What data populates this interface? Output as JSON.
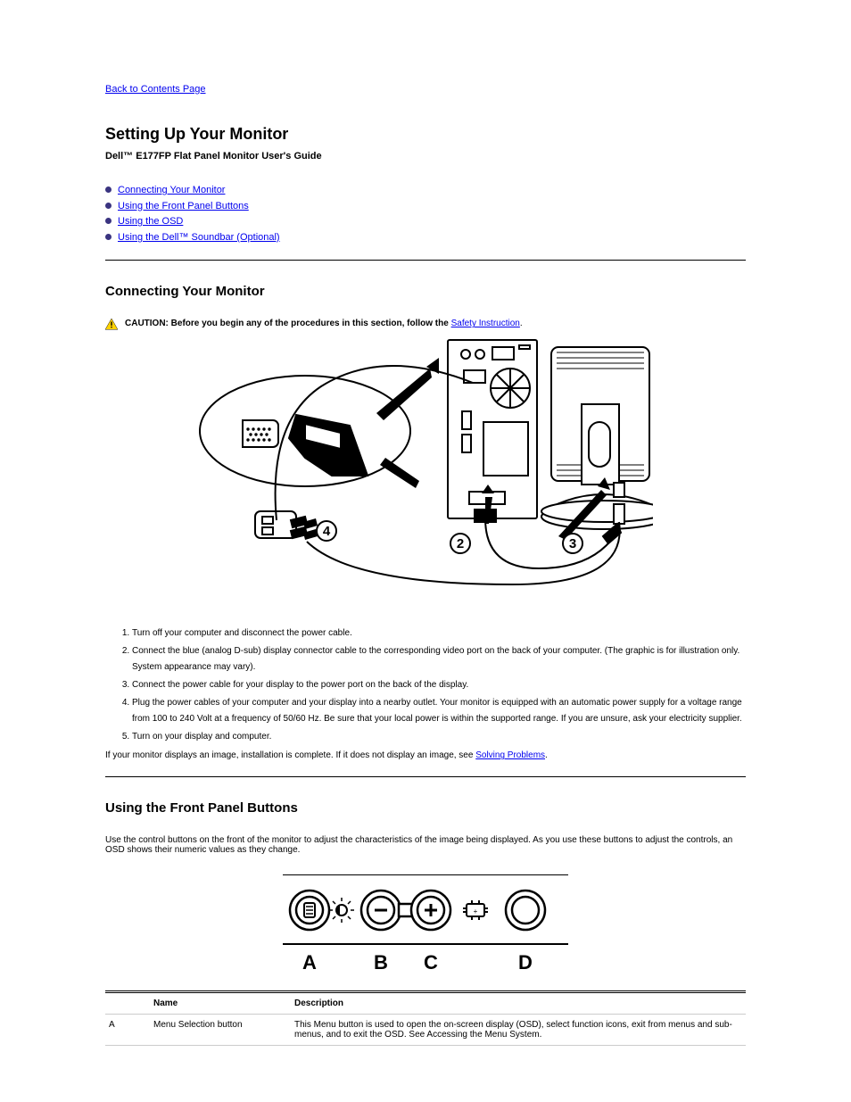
{
  "back_link": "Back to Contents Page",
  "page_title": "Setting Up Your Monitor",
  "product_line": "Dell™ E177FP Flat Panel Monitor User's Guide",
  "nav_links": [
    "Connecting Your Monitor",
    "Using the Front Panel Buttons",
    "Using the OSD",
    "Using the Dell™ Soundbar (Optional)"
  ],
  "section1_title": "Connecting Your Monitor",
  "caution_label": "CAUTION: Before you begin any of the procedures in this section, follow the ",
  "caution_link": "Safety Instruction",
  "caution_tail": ".",
  "figure_labels": {
    "c2": "2",
    "c3": "3",
    "c4": "4"
  },
  "steps": [
    "Turn off your computer and disconnect the power cable.",
    "Connect the blue (analog D-sub) display connector cable to the corresponding video port on the back of your computer. (The graphic is for illustration only. System appearance may vary).",
    "Connect the power cable for your display to the power port on the back of the display.",
    "Plug the power cables of your computer and your display into a nearby outlet. Your monitor is equipped with an automatic power supply for a voltage range from 100 to 240 Volt at a frequency of 50/60 Hz. Be sure that your local power is within the supported range. If you are unsure, ask your electricity supplier.",
    "Turn on your display and computer."
  ],
  "after_steps_pre": "If your monitor displays an image, installation is complete. If it does not display an image, see ",
  "after_steps_link": "Solving Problems",
  "after_steps_tail": ".",
  "section2_title": "Using the Front Panel Buttons",
  "panel_note": "Use the control buttons on the front of the monitor to adjust the characteristics of the image being displayed. As you use these buttons to adjust the controls, an OSD shows their numeric values as they change.",
  "panel_letters": {
    "a": "A",
    "b": "B",
    "c": "C",
    "d": "D"
  },
  "table": {
    "headers": [
      "",
      "Name",
      "Description"
    ],
    "rows": [
      {
        "key": "A",
        "name": "Menu Selection button",
        "desc": "This Menu button is used to open the on-screen display (OSD), select function icons, exit from menus and sub-menus, and to exit the OSD. See Accessing the Menu System."
      }
    ]
  }
}
